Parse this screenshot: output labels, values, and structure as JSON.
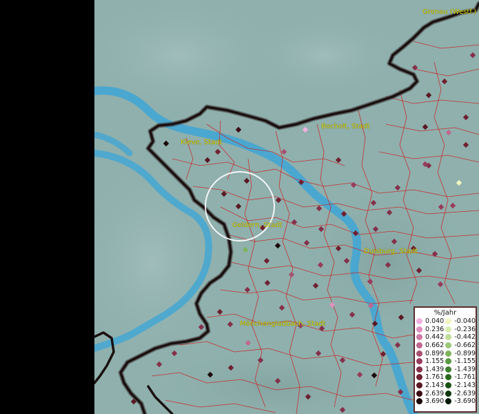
{
  "cities": [
    {
      "id": "gronau",
      "label": "Gronau (Westf.)"
    },
    {
      "id": "bocholt",
      "label": "Bocholt, Stadt"
    },
    {
      "id": "kleve",
      "label": "Kleve, Stadt"
    },
    {
      "id": "geldern",
      "label": "Geldern, Stadt"
    },
    {
      "id": "duisburg",
      "label": "Duisburg, Stadt"
    },
    {
      "id": "moenchengladbach",
      "label": "Mönchengladbach, Stadt"
    }
  ],
  "legend": {
    "title": "%/Jahr",
    "positive": [
      {
        "value": "0.040",
        "color": "#f0b0e0"
      },
      {
        "value": "0.236",
        "color": "#e090c0"
      },
      {
        "value": "0.442",
        "color": "#d07aa6"
      },
      {
        "value": "0.662",
        "color": "#c06890"
      },
      {
        "value": "0.899",
        "color": "#a85070"
      },
      {
        "value": "1.155",
        "color": "#983c5c"
      },
      {
        "value": "1.439",
        "color": "#85304a"
      },
      {
        "value": "1.761",
        "color": "#702030"
      },
      {
        "value": "2.143",
        "color": "#5a1822"
      },
      {
        "value": "2.639",
        "color": "#3e0c14"
      },
      {
        "value": "3.690",
        "color": "#1a0408"
      }
    ],
    "negative": [
      {
        "value": "-0.040",
        "color": "#f2f5c0"
      },
      {
        "value": "-0.236",
        "color": "#d8ecb0"
      },
      {
        "value": "-0.442",
        "color": "#bedd98"
      },
      {
        "value": "-0.662",
        "color": "#9cc878"
      },
      {
        "value": "-0.899",
        "color": "#7fb45e"
      },
      {
        "value": "-1.155",
        "color": "#5c9a42"
      },
      {
        "value": "-1.439",
        "color": "#3e7e2e"
      },
      {
        "value": "-1.761",
        "color": "#2a6820"
      },
      {
        "value": "-2.143",
        "color": "#1a5014"
      },
      {
        "value": "-2.639",
        "color": "#0e360c"
      },
      {
        "value": "-3.690",
        "color": "#041a04"
      }
    ]
  },
  "colors": {
    "terrain": "#8fb0ad",
    "river": "#3ea6d6",
    "border": "#1a1010",
    "district_lines": "#cc2222",
    "label": "#d8d800"
  }
}
